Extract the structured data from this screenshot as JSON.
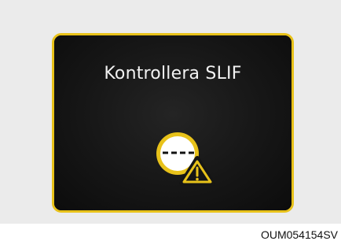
{
  "display": {
    "message": "Kontrollera SLIF",
    "icon": "slif-warning-icon",
    "frame_color": "#e8c21a",
    "screen_color": "#151515",
    "text_color": "#f2f2f2"
  },
  "caption": {
    "code": "OUM054154SV"
  }
}
